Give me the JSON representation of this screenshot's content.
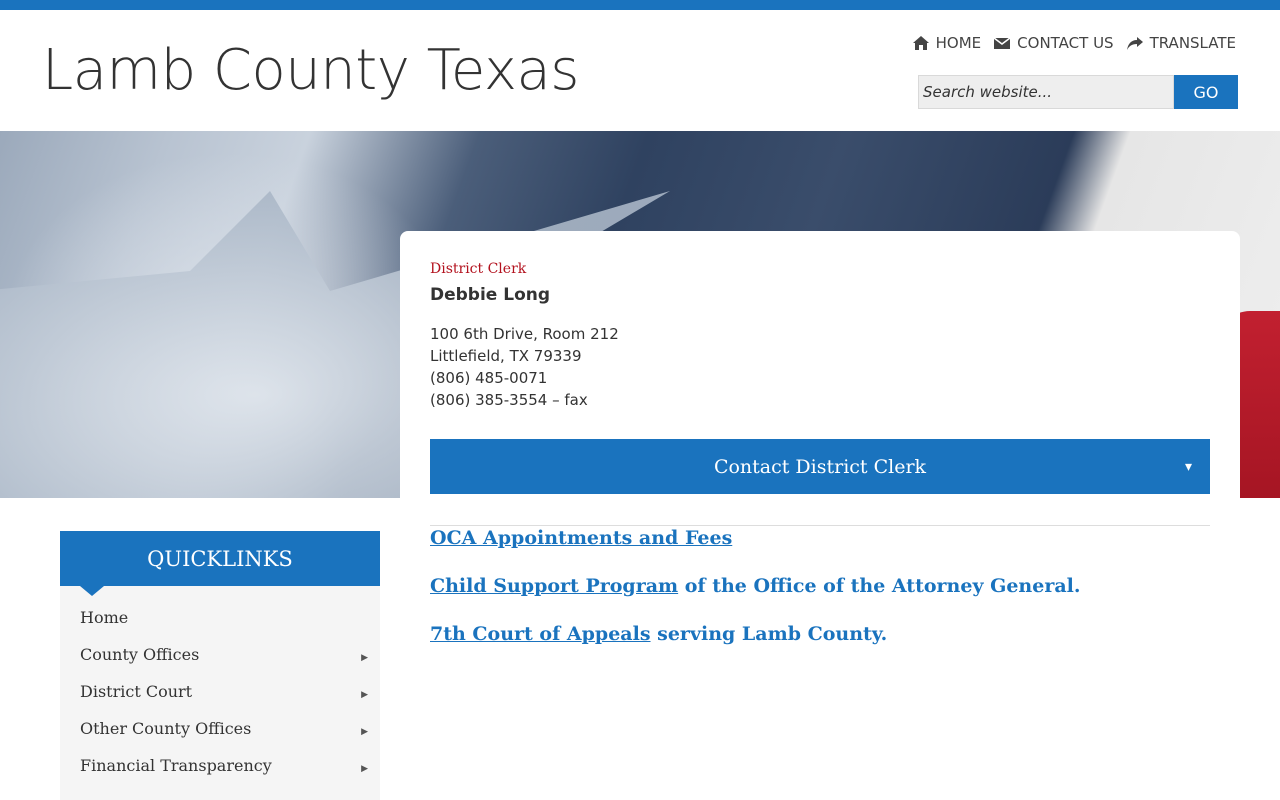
{
  "site": {
    "title": "Lamb County Texas"
  },
  "topnav": {
    "items": [
      {
        "label": "HOME",
        "icon": "home-icon"
      },
      {
        "label": "CONTACT US",
        "icon": "envelope-icon"
      },
      {
        "label": "TRANSLATE",
        "icon": "share-arrow-icon"
      }
    ]
  },
  "search": {
    "placeholder": "Search website...",
    "button_label": "GO"
  },
  "card": {
    "role": "District Clerk",
    "name": "Debbie Long",
    "address_line1": "100 6th Drive, Room 212",
    "address_line2": "Littlefield, TX  79339",
    "phone": "(806) 485-0071",
    "fax": "(806) 385-3554 – fax",
    "contact_button": "Contact District Clerk",
    "caret": "▾"
  },
  "links": [
    {
      "link_text": "OCA Appointments and Fees",
      "rest": ""
    },
    {
      "link_text": "Child Support Program",
      "rest": " of the Office of the Attorney General."
    },
    {
      "link_text": "7th Court of Appeals",
      "rest": " serving Lamb County."
    }
  ],
  "quicklinks": {
    "title": "QUICKLINKS",
    "items": [
      {
        "label": "Home",
        "has_submenu": false
      },
      {
        "label": "County Offices",
        "has_submenu": true
      },
      {
        "label": "District Court",
        "has_submenu": true
      },
      {
        "label": "Other County Offices",
        "has_submenu": true
      },
      {
        "label": "Financial Transparency",
        "has_submenu": true
      }
    ],
    "submenu_arrow": "▶"
  },
  "colors": {
    "accent": "#1a73be",
    "role_red": "#b3121e"
  }
}
